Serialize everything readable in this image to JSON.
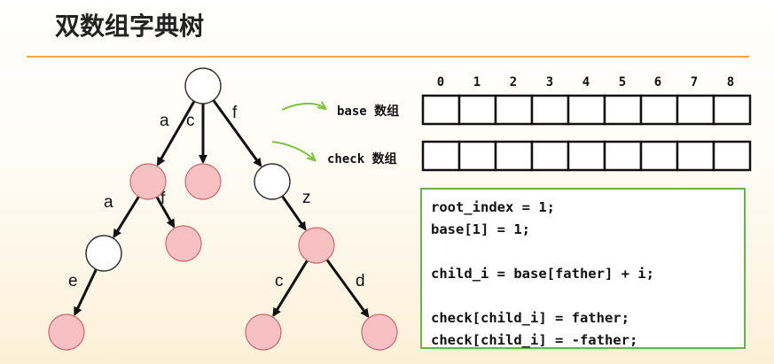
{
  "title": "双数组字典树",
  "tree": {
    "edge_labels": {
      "root_a": "a",
      "root_c": "c",
      "root_f": "f",
      "n1_a": "a",
      "n1_f": "f",
      "n3_z": "z",
      "n4_e": "e",
      "n6_c": "c",
      "n6_d": "d"
    },
    "colors": {
      "terminal_fill": "#f7c0c2",
      "terminal_stroke": "#c76a6e",
      "plain_fill": "#ffffff",
      "plain_stroke": "#333333"
    }
  },
  "arrays": {
    "indices": [
      "0",
      "1",
      "2",
      "3",
      "4",
      "5",
      "6",
      "7",
      "8"
    ],
    "base_label": "base 数组",
    "check_label": "check 数组",
    "arrow_color": "#7cc23a"
  },
  "code": {
    "lines": [
      "root_index = 1;",
      "base[1] = 1;",
      "",
      "child_i = base[father] + i;",
      "",
      "check[child_i] = father;",
      "check[child_i] = -father;"
    ],
    "border_color": "#6ab04c"
  }
}
